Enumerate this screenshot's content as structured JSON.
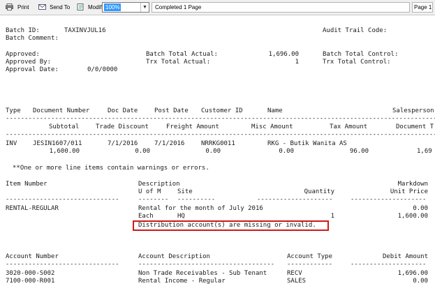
{
  "toolbar": {
    "print_label": "Print",
    "send_label": "Send To",
    "modify_label": "Modify",
    "zoom": "100%",
    "status": "Completed 1 Page",
    "page": "Page 1"
  },
  "batch": {
    "id_label": "Batch ID:",
    "id_value": "TAXINVJUL16",
    "audit_label": "Audit Trail Code:",
    "comment_label": "Batch Comment:",
    "approved_label": "Approved:",
    "approved_by_label": "Approved By:",
    "approval_date_label": "Approval Date:",
    "approval_date_value": "0/0/0000",
    "total_actual_label": "Batch Total Actual:",
    "total_actual_value": "1,696.00",
    "trx_actual_label": "Trx Total Actual:",
    "trx_actual_value": "1",
    "total_control_label": "Batch Total Control:",
    "trx_control_label": "Trx Total Control:"
  },
  "header1": [
    "Type",
    "Document Number",
    "Doc Date",
    "Post Date",
    "Customer ID",
    "Name",
    "Salesperson"
  ],
  "header2": [
    "Subtotal",
    "Trade Discount",
    "Freight Amount",
    "Misc Amount",
    "Tax Amount",
    "Document T"
  ],
  "doc": {
    "type": "INV",
    "number": "JESIN1607/011",
    "doc_date": "7/1/2016",
    "post_date": "7/1/2016",
    "customer_id": "NRRKG0011",
    "name": "RKG - Butik Wanita AS",
    "subtotal": "1,600.00",
    "trade_discount": "0.00",
    "freight": "0.00",
    "misc": "0.00",
    "tax": "96.00",
    "doc_total": "1,69"
  },
  "warning": "**One or more line items contain warnings or errors.",
  "line_header": {
    "item_number": "Item Number",
    "description": "Description",
    "markdown": "Markdown",
    "uofm": "U of M",
    "site": "Site",
    "quantity": "Quantity",
    "unit_price": "Unit Price"
  },
  "line": {
    "item": "RENTAL-REGULAR",
    "description": "Rental for the month of July 2016",
    "markdown": "0.00",
    "uofm": "Each",
    "site": "HQ",
    "quantity": "1",
    "unit_price": "1,600.00",
    "error": "Distribution account(s) are missing or invalid."
  },
  "dist_header": [
    "Account Number",
    "Account Description",
    "Account Type",
    "Debit Amount"
  ],
  "dist_rows": [
    {
      "account": "3020-000-S002",
      "description": "Non Trade Receivables - Sub Tenant",
      "type": "RECV",
      "debit": "1,696.00"
    },
    {
      "account": "7100-000-R001",
      "description": "Rental Income - Regular",
      "type": "SALES",
      "debit": "0.00"
    }
  ],
  "colors": {
    "highlight": "#d01818",
    "zoom_selected": "#3399ff"
  }
}
